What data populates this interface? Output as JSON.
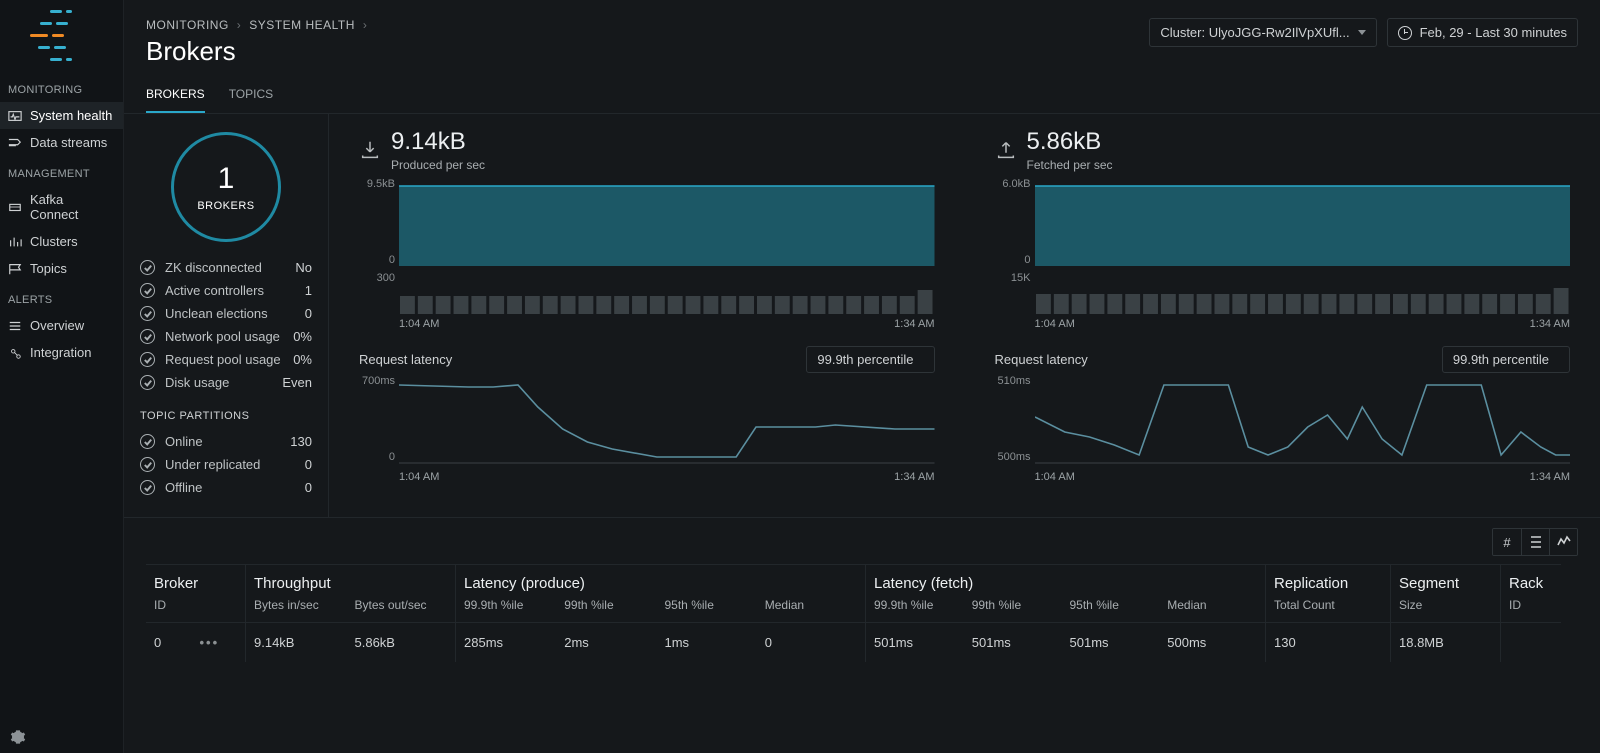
{
  "header": {
    "breadcrumbs": [
      "MONITORING",
      "SYSTEM HEALTH"
    ],
    "page_title": "Brokers",
    "cluster_selector": "Cluster: UlyoJGG-Rw2IlVpXUfl...",
    "time_selector": "Feb, 29 - Last 30 minutes"
  },
  "sidebar": {
    "sections": [
      {
        "title": "MONITORING",
        "items": [
          "System health",
          "Data streams"
        ]
      },
      {
        "title": "MANAGEMENT",
        "items": [
          "Kafka Connect",
          "Clusters",
          "Topics"
        ]
      },
      {
        "title": "ALERTS",
        "items": [
          "Overview",
          "Integration"
        ]
      }
    ],
    "active": "System health"
  },
  "tabs": [
    "BROKERS",
    "TOPICS"
  ],
  "tab_active": "BROKERS",
  "gauge": {
    "value": "1",
    "label": "BROKERS"
  },
  "status": [
    {
      "label": "ZK disconnected",
      "value": "No"
    },
    {
      "label": "Active controllers",
      "value": "1"
    },
    {
      "label": "Unclean elections",
      "value": "0"
    },
    {
      "label": "Network pool usage",
      "value": "0%"
    },
    {
      "label": "Request pool usage",
      "value": "0%"
    },
    {
      "label": "Disk usage",
      "value": "Even"
    }
  ],
  "partitions_hdr": "TOPIC PARTITIONS",
  "partitions": [
    {
      "label": "Online",
      "value": "130"
    },
    {
      "label": "Under replicated",
      "value": "0"
    },
    {
      "label": "Offline",
      "value": "0"
    }
  ],
  "produced": {
    "value": "9.14kB",
    "sub": "Produced per sec",
    "y_top": "9.5kB",
    "y_zero": "0",
    "bars_top": "300",
    "x0": "1:04 AM",
    "x1": "1:34 AM"
  },
  "fetched": {
    "value": "5.86kB",
    "sub": "Fetched per sec",
    "y_top": "6.0kB",
    "y_zero": "0",
    "bars_top": "15K",
    "x0": "1:04 AM",
    "x1": "1:34 AM"
  },
  "latency_label": "Request latency",
  "percentile": "99.9th percentile",
  "lat_produce": {
    "y0": "700ms",
    "y1": "0",
    "x0": "1:04 AM",
    "x1": "1:34 AM"
  },
  "lat_fetch": {
    "y0": "510ms",
    "y1": "500ms",
    "x0": "1:04 AM",
    "x1": "1:34 AM"
  },
  "chart_data": [
    {
      "type": "area",
      "title": "Produced per sec",
      "ylabel": "bytes",
      "ylim": [
        0,
        9500
      ],
      "series": [
        {
          "name": "produced",
          "values": [
            9140,
            9140,
            9140,
            9140,
            9140,
            9140,
            9140,
            9140,
            9140,
            9140,
            9140,
            9140,
            9140,
            9140,
            9140,
            9140,
            9140,
            9140,
            9140,
            9140,
            9140,
            9140,
            9140,
            9140,
            9140,
            9140,
            9140,
            9140,
            9140,
            9140
          ]
        }
      ],
      "xrange": [
        "1:04 AM",
        "1:34 AM"
      ]
    },
    {
      "type": "bar",
      "title": "Produced count",
      "ylim": [
        0,
        300
      ],
      "values": [
        150,
        150,
        150,
        150,
        150,
        150,
        150,
        150,
        150,
        150,
        150,
        150,
        150,
        150,
        150,
        150,
        150,
        150,
        150,
        150,
        150,
        150,
        150,
        150,
        150,
        150,
        150,
        150,
        150,
        170
      ],
      "xrange": [
        "1:04 AM",
        "1:34 AM"
      ]
    },
    {
      "type": "area",
      "title": "Fetched per sec",
      "ylabel": "bytes",
      "ylim": [
        0,
        6000
      ],
      "series": [
        {
          "name": "fetched",
          "values": [
            5860,
            5860,
            5860,
            5860,
            5860,
            5860,
            5860,
            5860,
            5860,
            5860,
            5860,
            5860,
            5860,
            5860,
            5860,
            5860,
            5860,
            5860,
            5860,
            5860,
            5860,
            5860,
            5860,
            5860,
            5860,
            5860,
            5860,
            5860,
            5860,
            5860
          ]
        }
      ],
      "xrange": [
        "1:04 AM",
        "1:34 AM"
      ]
    },
    {
      "type": "bar",
      "title": "Fetched count",
      "ylim": [
        0,
        15000
      ],
      "values": [
        8000,
        8000,
        8000,
        8000,
        8000,
        8000,
        8000,
        8000,
        8000,
        8000,
        8000,
        8000,
        8000,
        8000,
        8000,
        8000,
        8000,
        8000,
        8000,
        8000,
        8000,
        8000,
        8000,
        8000,
        8000,
        8000,
        8000,
        8000,
        8000,
        8000
      ],
      "xrange": [
        "1:04 AM",
        "1:34 AM"
      ]
    },
    {
      "type": "line",
      "title": "Produce request latency 99.9th",
      "ylabel": "ms",
      "ylim": [
        0,
        700
      ],
      "values": [
        640,
        620,
        620,
        620,
        620,
        620,
        640,
        500,
        280,
        180,
        130,
        110,
        90,
        60,
        60,
        60,
        60,
        60,
        60,
        285,
        285,
        285,
        300,
        280,
        280,
        280,
        280,
        280,
        280,
        280
      ],
      "xrange": [
        "1:04 AM",
        "1:34 AM"
      ]
    },
    {
      "type": "line",
      "title": "Fetch request latency 99.9th",
      "ylabel": "ms",
      "ylim": [
        500,
        510
      ],
      "values": [
        505,
        504,
        503,
        502,
        501,
        501,
        502,
        509,
        509,
        509,
        502,
        501,
        501,
        503,
        505,
        503,
        506,
        502,
        502,
        509,
        509,
        509,
        509,
        501,
        502,
        503,
        501,
        502,
        501,
        501
      ],
      "xrange": [
        "1:04 AM",
        "1:34 AM"
      ]
    }
  ],
  "table": {
    "sections": [
      {
        "title": "Broker",
        "cols": [
          "ID"
        ]
      },
      {
        "title": "Throughput",
        "cols": [
          "Bytes in/sec",
          "Bytes out/sec"
        ]
      },
      {
        "title": "Latency (produce)",
        "cols": [
          "99.9th %ile",
          "99th %ile",
          "95th %ile",
          "Median"
        ]
      },
      {
        "title": "Latency (fetch)",
        "cols": [
          "99.9th %ile",
          "99th %ile",
          "95th %ile",
          "Median"
        ]
      },
      {
        "title": "Replication",
        "cols": [
          "Total Count"
        ]
      },
      {
        "title": "Segment",
        "cols": [
          "Size"
        ]
      },
      {
        "title": "Rack",
        "cols": [
          "ID"
        ]
      }
    ],
    "rows": [
      {
        "broker": "0",
        "bytes_in": "9.14kB",
        "bytes_out": "5.86kB",
        "p_999": "285ms",
        "p_99": "2ms",
        "p_95": "1ms",
        "p_med": "0",
        "f_999": "501ms",
        "f_99": "501ms",
        "f_95": "501ms",
        "f_med": "500ms",
        "repl": "130",
        "seg": "18.8MB",
        "rack": ""
      }
    ]
  }
}
